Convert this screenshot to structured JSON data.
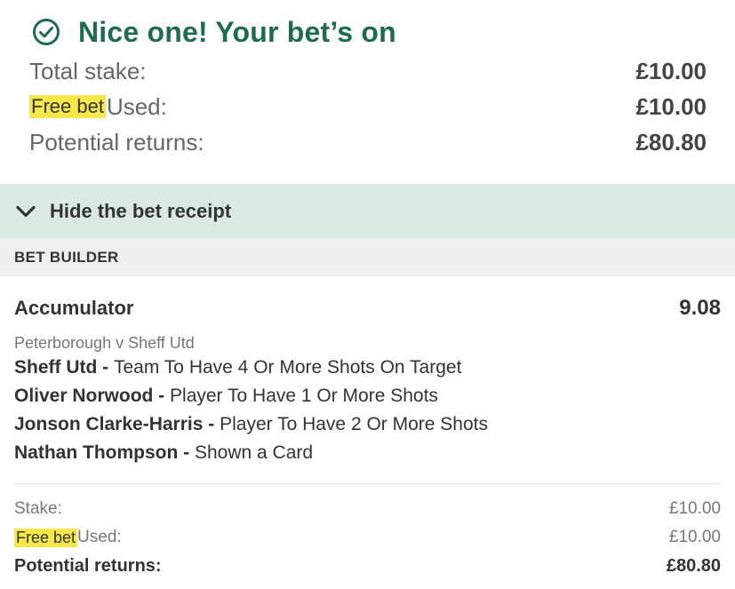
{
  "confirmation": {
    "title": "Nice one! Your bet’s on",
    "total_stake_label": "Total stake:",
    "total_stake_value": "£10.00",
    "free_bet_tag": "Free bet",
    "used_label": "Used:",
    "used_value": "£10.00",
    "potential_returns_label": "Potential returns:",
    "potential_returns_value": "£80.80"
  },
  "receipt_toggle": {
    "label": "Hide the bet receipt"
  },
  "section": {
    "label": "BET BUILDER"
  },
  "bet": {
    "type": "Accumulator",
    "odds": "9.08",
    "event": "Peterborough v Sheff Utd",
    "selections": [
      {
        "name": "Sheff Utd -",
        "market": "Team To Have 4 Or More Shots On Target"
      },
      {
        "name": "Oliver Norwood -",
        "market": "Player To Have 1 Or More Shots"
      },
      {
        "name": "Jonson Clarke-Harris -",
        "market": "Player To Have 2 Or More Shots"
      },
      {
        "name": "Nathan Thompson -",
        "market": "Shown a Card"
      }
    ],
    "stake_label": "Stake:",
    "stake_value": "£10.00",
    "free_bet_tag": "Free bet",
    "used_label": "Used:",
    "used_value": "£10.00",
    "returns_label": "Potential returns:",
    "returns_value": "£80.80"
  },
  "colors": {
    "success_green": "#1f6b51",
    "toggle_bg": "#dce9e2",
    "section_bg": "#efefef",
    "highlight_yellow": "#f7e84a"
  },
  "icons": {
    "success": "check-circle-icon",
    "toggle": "chevron-down-icon"
  }
}
